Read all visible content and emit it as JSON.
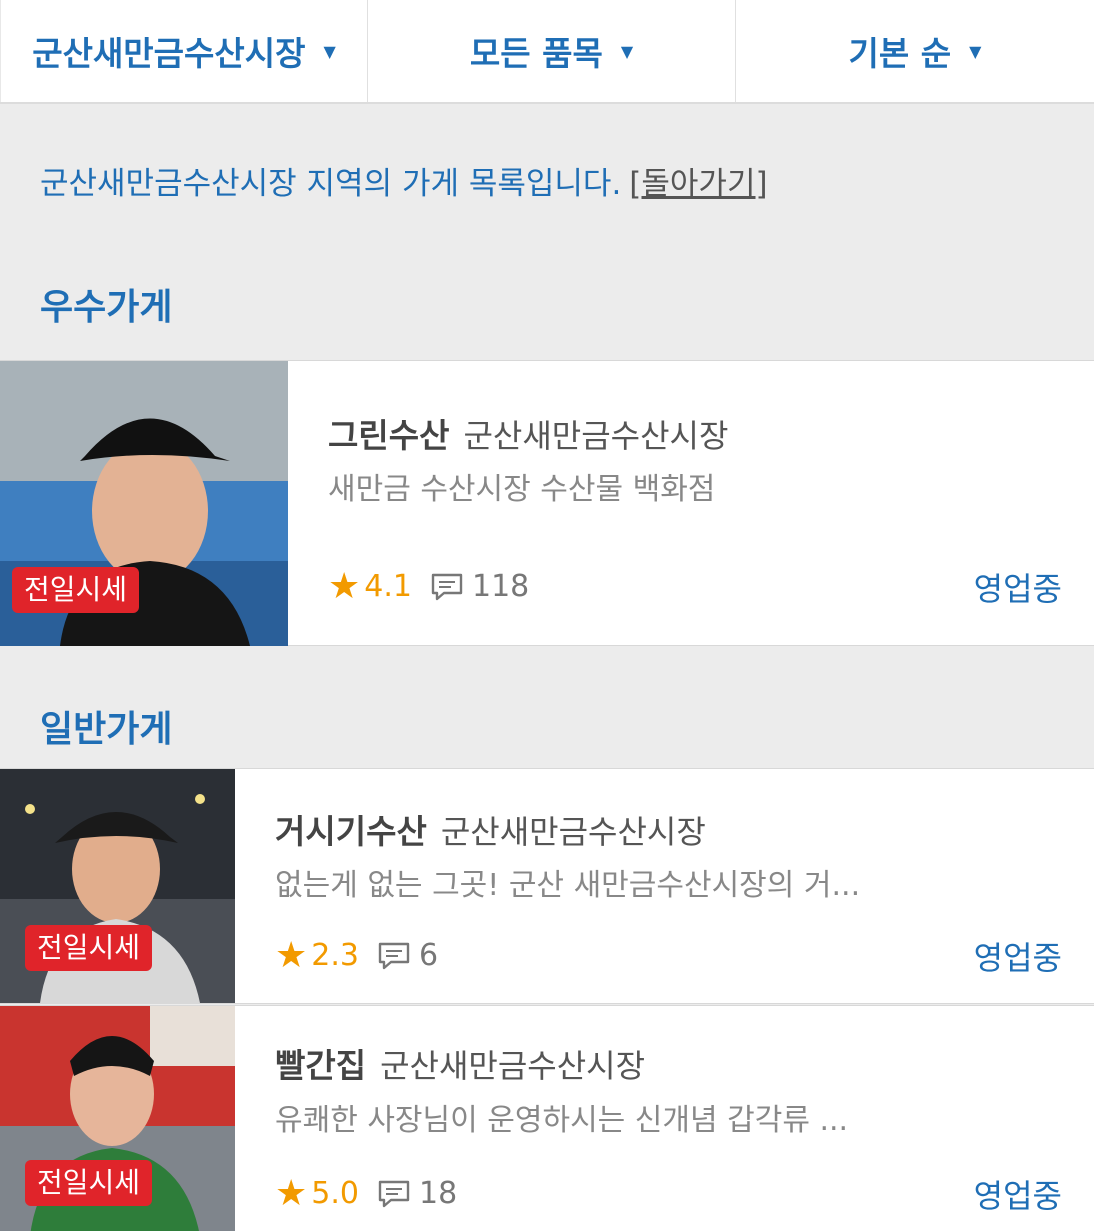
{
  "filters": {
    "market": "군산새만금수산시장",
    "category": "모든 품목",
    "sort": "기본 순",
    "caret": "▼"
  },
  "intro": {
    "text": "군산새만금수산시장 지역의 가게 목록입니다.",
    "back": "[돌아가기]"
  },
  "sections": {
    "premium": "우수가게",
    "general": "일반가게"
  },
  "stores": [
    {
      "name": "그린수산",
      "market": "군산새만금수산시장",
      "desc": "새만금 수산시장 수산물 백화점",
      "rating": "4.1",
      "reviews": "118",
      "status": "영업중",
      "tag": "전일시세"
    },
    {
      "name": "거시기수산",
      "market": "군산새만금수산시장",
      "desc": "없는게 없는 그곳! 군산 새만금수산시장의 거...",
      "rating": "2.3",
      "reviews": "6",
      "status": "영업중",
      "tag": "전일시세"
    },
    {
      "name": "빨간집",
      "market": "군산새만금수산시장",
      "desc": "유쾌한 사장님이 운영하시는 신개념 갑각류 ...",
      "rating": "5.0",
      "reviews": "18",
      "status": "영업중",
      "tag": "전일시세"
    }
  ],
  "colors": {
    "accent": "#1f6eb5",
    "star": "#f29a00",
    "tag": "#e0242a"
  }
}
